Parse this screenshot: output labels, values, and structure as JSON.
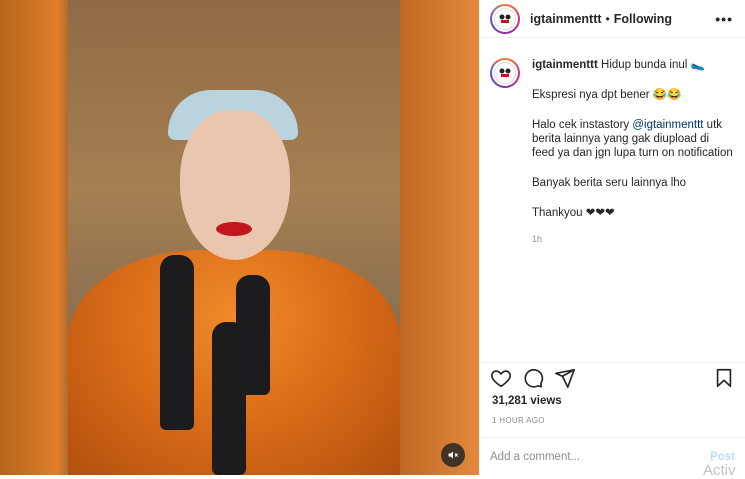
{
  "post": {
    "username": "igtainmenttt",
    "follow_label": "Following",
    "more_label": "•••"
  },
  "caption": {
    "username": "igtainmenttt",
    "line1": "Hidup bunda inul 🥿",
    "line2": "Ekspresi nya dpt bener 😂😂",
    "line3_pre": "Halo cek instastory ",
    "line3_mention": "@igtainmenttt",
    "line3_post": " utk berita lainnya yang gak diupload di feed ya dan jgn lupa turn on notification",
    "line4": "Banyak berita seru lainnya lho",
    "line5": "Thankyou ❤❤❤",
    "age": "1h"
  },
  "stats": {
    "views": "31,281 views",
    "time": "1 HOUR AGO"
  },
  "comment_box": {
    "placeholder": "Add a comment...",
    "post_label": "Post"
  },
  "overlay": {
    "watermark": "Activ"
  },
  "colors": {
    "link": "#00376b",
    "muted": "#8e8e8e",
    "post_disabled": "#b2dffc"
  }
}
